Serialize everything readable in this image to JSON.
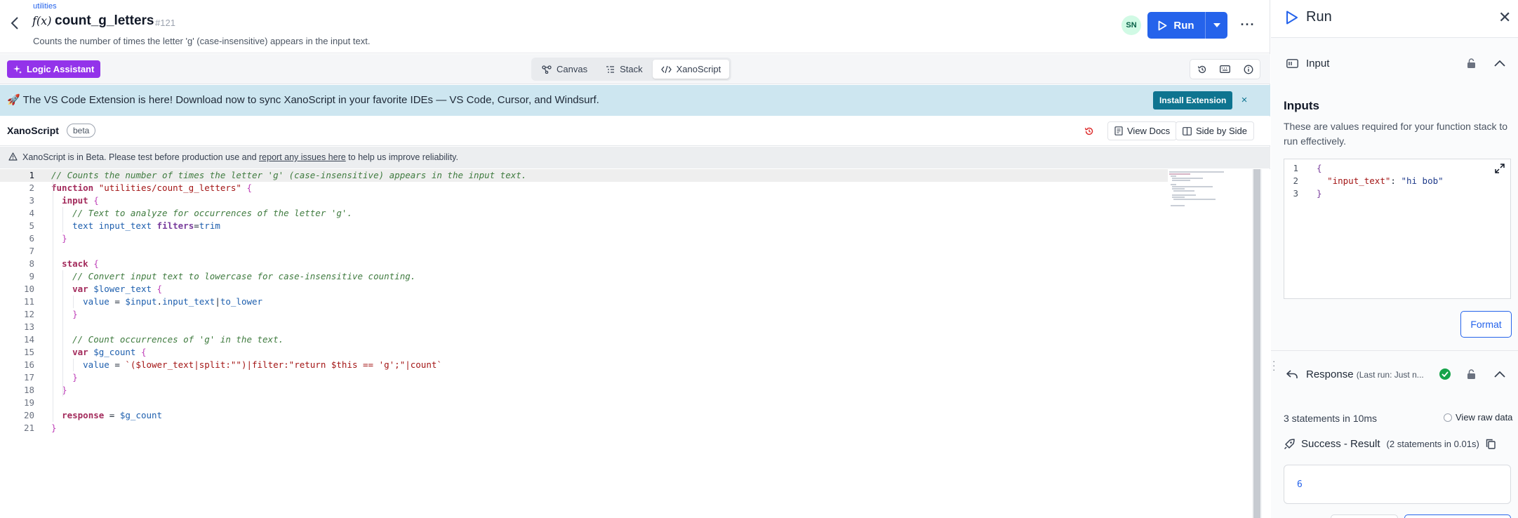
{
  "header": {
    "breadcrumb": "utilities",
    "fx_symbol": "f(x)",
    "function_name": "count_g_letters",
    "function_id": "#121",
    "description": "Counts the number of times the letter 'g' (case-insensitive) appears in the input text.",
    "avatar_initials": "SN",
    "run_label": "Run",
    "more_label": "···"
  },
  "toolbar": {
    "logic_assistant_label": "Logic Assistant",
    "tabs": [
      {
        "label": "Canvas",
        "icon": "canvas-icon",
        "active": false
      },
      {
        "label": "Stack",
        "icon": "stack-icon",
        "active": false
      },
      {
        "label": "XanoScript",
        "icon": "code-icon",
        "active": true
      }
    ],
    "right_icons": [
      "history-icon",
      "keyboard-icon",
      "info-icon"
    ]
  },
  "banner": {
    "emoji": "🚀",
    "text": "The VS Code Extension is here! Download now to sync XanoScript in your favorite IDEs — VS Code, Cursor, and Windsurf.",
    "install_label": "Install Extension",
    "close_label": "×"
  },
  "xanoscript_bar": {
    "title": "XanoScript",
    "badge": "beta",
    "view_docs_label": "View Docs",
    "side_by_side_label": "Side by Side"
  },
  "warning": {
    "before": "XanoScript is in Beta. Please test before production use and ",
    "link": "report any issues here",
    "after": " to help us improve reliability."
  },
  "editor": {
    "current_line": 1,
    "lines": [
      [
        {
          "t": "com",
          "v": "// Counts the number of times the letter 'g' (case-insensitive) appears in the input text."
        }
      ],
      [
        {
          "t": "kw",
          "v": "function"
        },
        {
          "t": "plain",
          "v": " "
        },
        {
          "t": "str",
          "v": "\"utilities/count_g_letters\""
        },
        {
          "t": "plain",
          "v": " "
        },
        {
          "t": "punc",
          "v": "{"
        }
      ],
      [
        {
          "t": "plain",
          "v": "  "
        },
        {
          "t": "kw",
          "v": "input"
        },
        {
          "t": "plain",
          "v": " "
        },
        {
          "t": "punc",
          "v": "{"
        }
      ],
      [
        {
          "t": "plain",
          "v": "    "
        },
        {
          "t": "com",
          "v": "// Text to analyze for occurrences of the letter 'g'."
        }
      ],
      [
        {
          "t": "plain",
          "v": "    "
        },
        {
          "t": "id",
          "v": "text"
        },
        {
          "t": "plain",
          "v": " "
        },
        {
          "t": "id",
          "v": "input_text"
        },
        {
          "t": "plain",
          "v": " "
        },
        {
          "t": "attr",
          "v": "filters"
        },
        {
          "t": "plain",
          "v": "="
        },
        {
          "t": "id",
          "v": "trim"
        }
      ],
      [
        {
          "t": "plain",
          "v": "  "
        },
        {
          "t": "punc",
          "v": "}"
        }
      ],
      [],
      [
        {
          "t": "plain",
          "v": "  "
        },
        {
          "t": "kw",
          "v": "stack"
        },
        {
          "t": "plain",
          "v": " "
        },
        {
          "t": "punc",
          "v": "{"
        }
      ],
      [
        {
          "t": "plain",
          "v": "    "
        },
        {
          "t": "com",
          "v": "// Convert input text to lowercase for case-insensitive counting."
        }
      ],
      [
        {
          "t": "plain",
          "v": "    "
        },
        {
          "t": "kw",
          "v": "var"
        },
        {
          "t": "plain",
          "v": " "
        },
        {
          "t": "var",
          "v": "$lower_text"
        },
        {
          "t": "plain",
          "v": " "
        },
        {
          "t": "punc",
          "v": "{"
        }
      ],
      [
        {
          "t": "plain",
          "v": "      "
        },
        {
          "t": "id",
          "v": "value"
        },
        {
          "t": "plain",
          "v": " = "
        },
        {
          "t": "var",
          "v": "$input"
        },
        {
          "t": "plain",
          "v": "."
        },
        {
          "t": "id",
          "v": "input_text"
        },
        {
          "t": "plain",
          "v": "|"
        },
        {
          "t": "id",
          "v": "to_lower"
        }
      ],
      [
        {
          "t": "plain",
          "v": "    "
        },
        {
          "t": "punc",
          "v": "}"
        }
      ],
      [],
      [
        {
          "t": "plain",
          "v": "    "
        },
        {
          "t": "com",
          "v": "// Count occurrences of 'g' in the text."
        }
      ],
      [
        {
          "t": "plain",
          "v": "    "
        },
        {
          "t": "kw",
          "v": "var"
        },
        {
          "t": "plain",
          "v": " "
        },
        {
          "t": "var",
          "v": "$g_count"
        },
        {
          "t": "plain",
          "v": " "
        },
        {
          "t": "punc",
          "v": "{"
        }
      ],
      [
        {
          "t": "plain",
          "v": "      "
        },
        {
          "t": "id",
          "v": "value"
        },
        {
          "t": "plain",
          "v": " = "
        },
        {
          "t": "str",
          "v": "`($lower_text|split:\"\")|filter:\"return $this == 'g';\"|count`"
        }
      ],
      [
        {
          "t": "plain",
          "v": "    "
        },
        {
          "t": "punc",
          "v": "}"
        }
      ],
      [
        {
          "t": "plain",
          "v": "  "
        },
        {
          "t": "punc",
          "v": "}"
        }
      ],
      [],
      [
        {
          "t": "plain",
          "v": "  "
        },
        {
          "t": "kw",
          "v": "response"
        },
        {
          "t": "plain",
          "v": " = "
        },
        {
          "t": "var",
          "v": "$g_count"
        }
      ],
      [
        {
          "t": "punc",
          "v": "}"
        }
      ]
    ]
  },
  "run_panel": {
    "title": "Run",
    "close_label": "✕",
    "input_section_label": "Input",
    "inputs_title": "Inputs",
    "inputs_description": "These are values required for your function stack to run effectively.",
    "json_lines": [
      [
        {
          "t": "brace",
          "v": "{"
        }
      ],
      [
        {
          "t": "plain",
          "v": "  "
        },
        {
          "t": "key",
          "v": "\"input_text\""
        },
        {
          "t": "plain",
          "v": ": "
        },
        {
          "t": "str",
          "v": "\"hi bob\""
        }
      ],
      [
        {
          "t": "brace",
          "v": "}"
        }
      ]
    ],
    "format_label": "Format",
    "response_label": "Response",
    "last_run_label": "(Last run: Just n...",
    "statements_text": "3 statements in 10ms",
    "view_raw_label": "View raw data",
    "success_label": "Success - Result",
    "success_sub": "(2 statements in 0.01s)",
    "result_value": "6"
  },
  "colors": {
    "primary": "#2563eb",
    "logic_assistant": "#9333ea",
    "banner_bg": "#cde6f0",
    "install_btn": "#0e7490",
    "success": "#16a34a"
  }
}
